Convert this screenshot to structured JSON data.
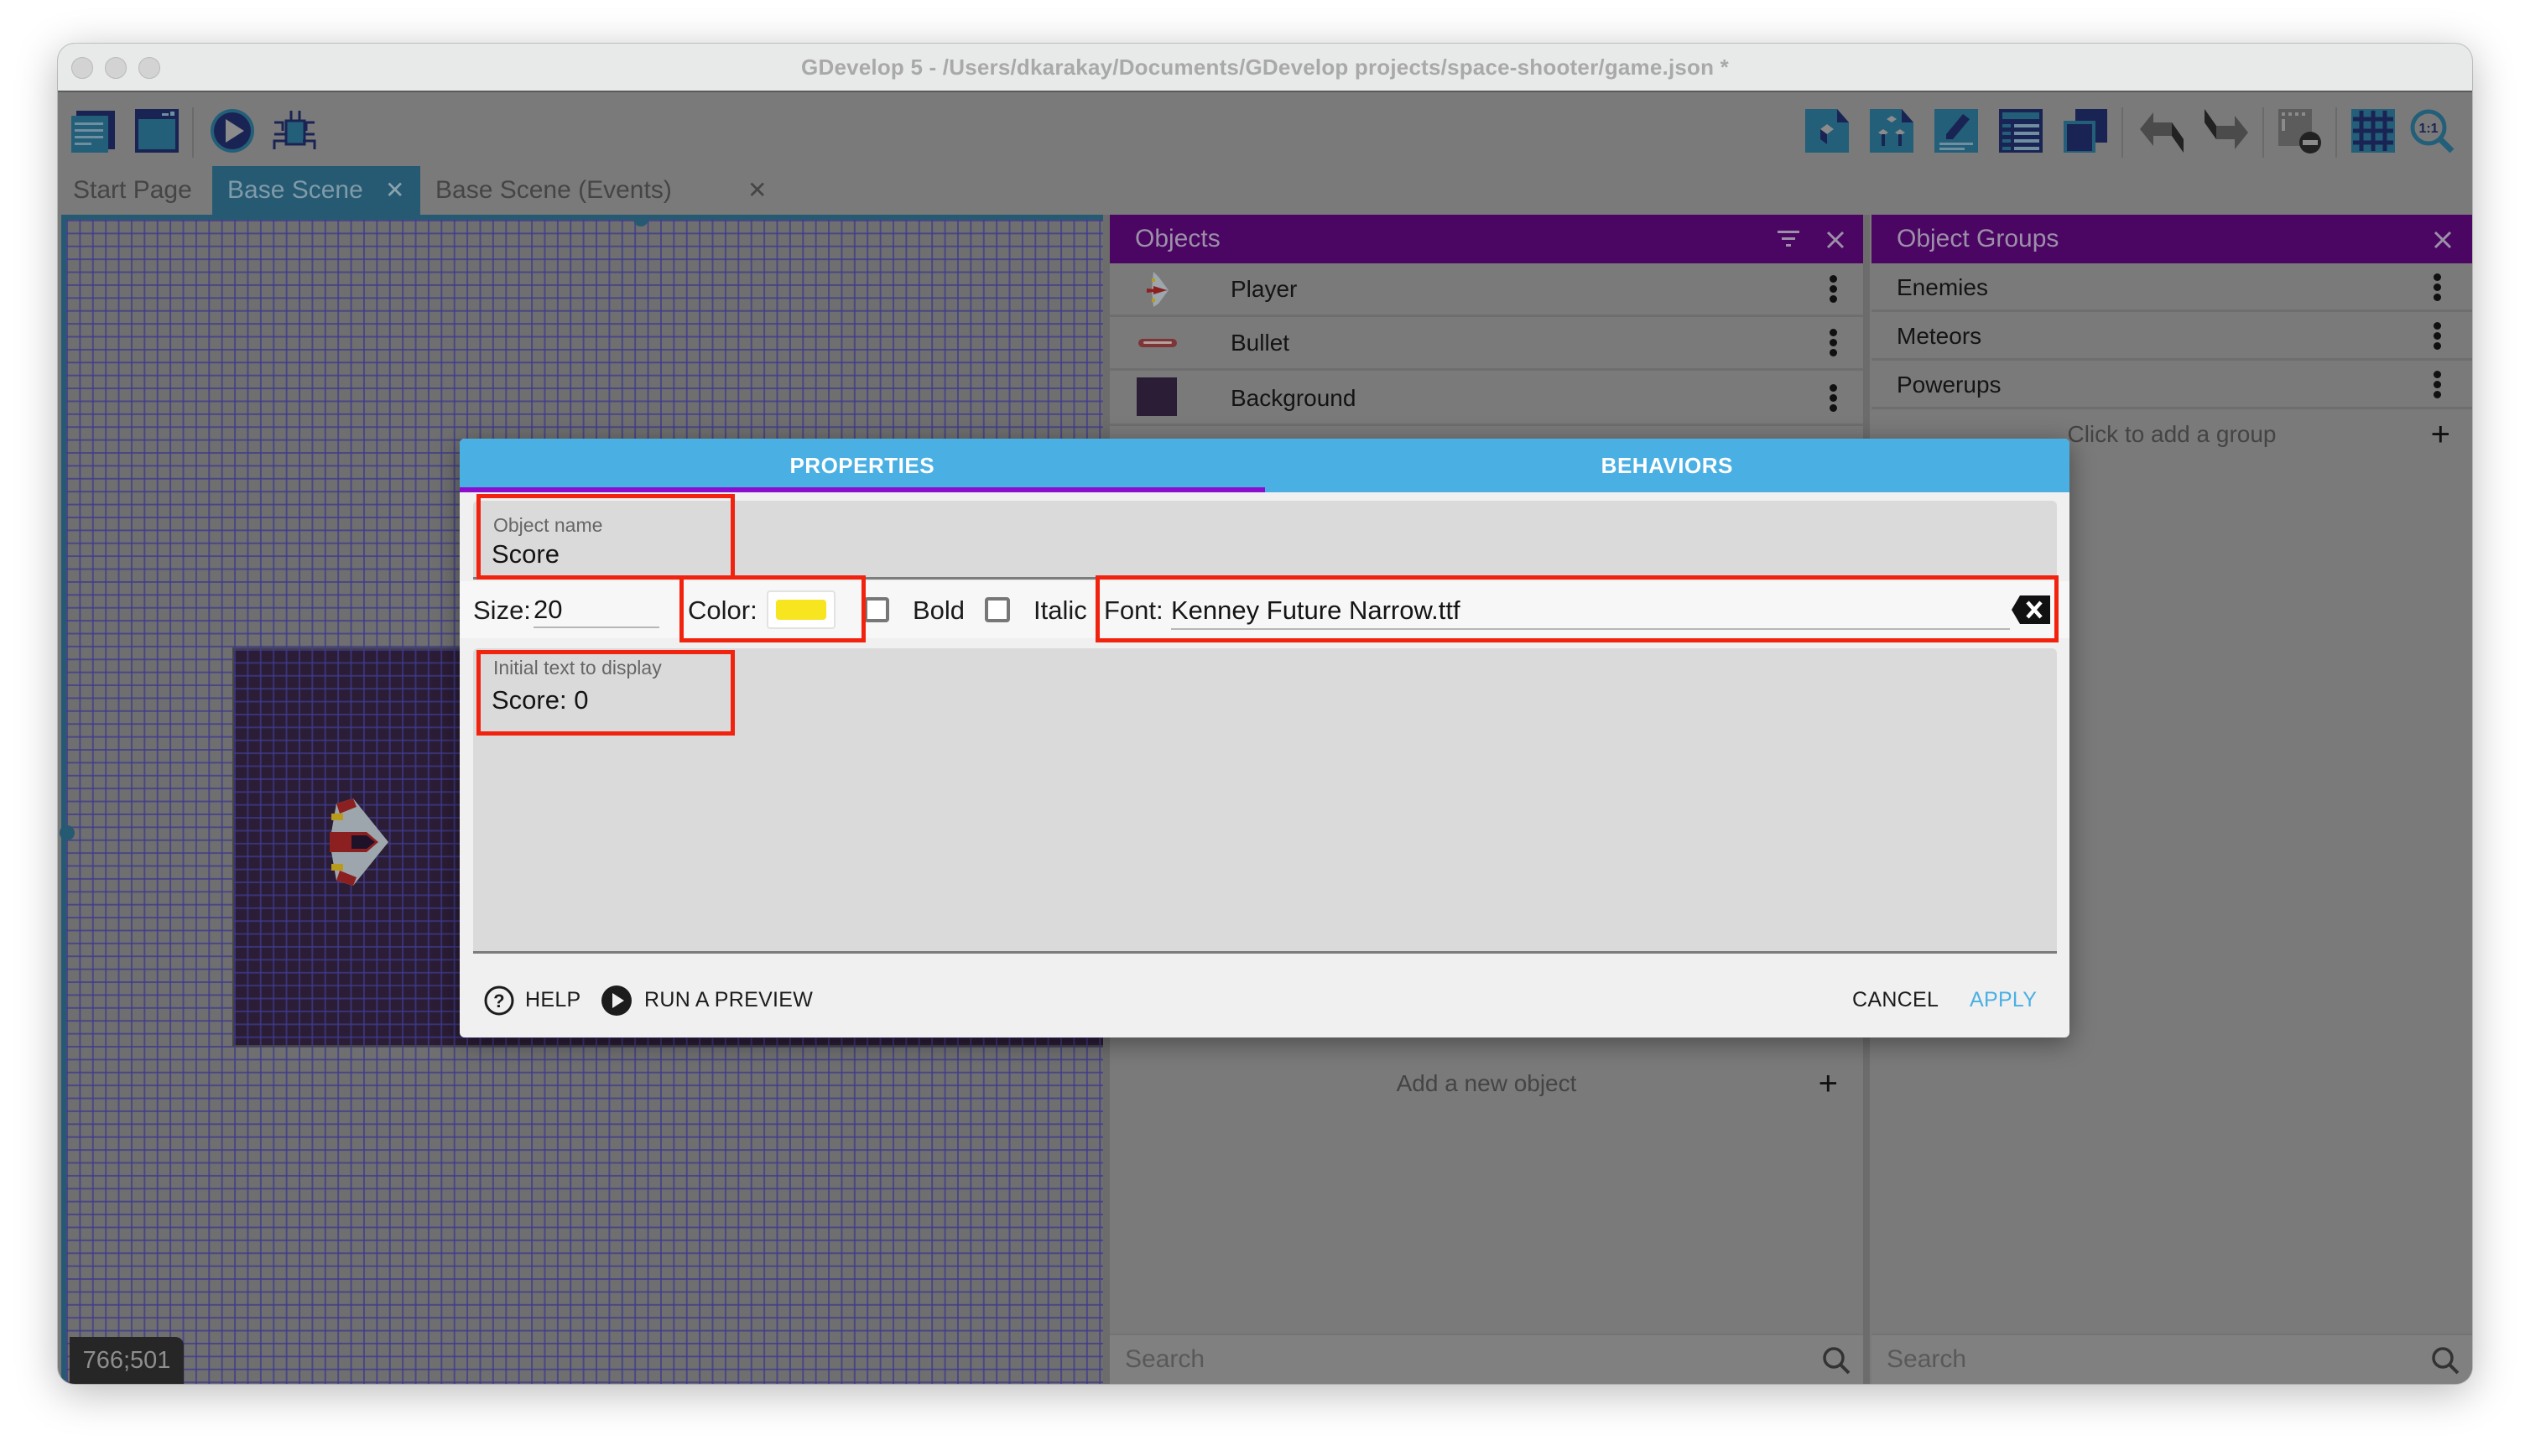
{
  "window": {
    "title": "GDevelop 5 - /Users/dkarakay/Documents/GDevelop projects/space-shooter/game.json *"
  },
  "toolbar": {
    "left_icons": [
      "project-manager-icon",
      "scene-editor-icon",
      "preview-icon",
      "debugger-icon"
    ],
    "right_icons": [
      "object-icon",
      "object-groups-icon",
      "properties-icon",
      "instances-list-icon",
      "layers-icon",
      "undo-icon",
      "redo-icon",
      "delete-icon",
      "grid-icon",
      "zoom-reset-icon"
    ],
    "zoom_reset_label": "1:1"
  },
  "tabs": [
    {
      "label": "Start Page",
      "active": false,
      "closable": false
    },
    {
      "label": "Base Scene",
      "active": true,
      "closable": true
    },
    {
      "label": "Base Scene (Events)",
      "active": false,
      "closable": true
    }
  ],
  "tab_close_glyph": "✕",
  "canvas": {
    "cursor_coords": "766;501"
  },
  "objects_panel": {
    "title": "Objects",
    "items": [
      {
        "name": "Player",
        "thumb": "ship"
      },
      {
        "name": "Bullet",
        "thumb": "bullet"
      },
      {
        "name": "Background",
        "thumb": "background"
      }
    ],
    "add_label": "Add a new object",
    "search_placeholder": "Search"
  },
  "groups_panel": {
    "title": "Object Groups",
    "items": [
      {
        "name": "Enemies"
      },
      {
        "name": "Meteors"
      },
      {
        "name": "Powerups"
      }
    ],
    "add_label": "Click to add a group",
    "search_placeholder": "Search"
  },
  "dialog": {
    "tabs": [
      {
        "label": "PROPERTIES",
        "active": true
      },
      {
        "label": "BEHAVIORS",
        "active": false
      }
    ],
    "object_name": {
      "label": "Object name",
      "value": "Score"
    },
    "size": {
      "label": "Size:",
      "value": "20"
    },
    "color": {
      "label": "Color:",
      "value": "#f7e51f"
    },
    "bold": {
      "label": "Bold",
      "checked": false
    },
    "italic": {
      "label": "Italic",
      "checked": false
    },
    "font": {
      "label": "Font:",
      "value": "Kenney Future Narrow.ttf"
    },
    "initial_text": {
      "label": "Initial text to display",
      "value": "Score: 0"
    },
    "footer": {
      "help": "HELP",
      "preview": "RUN A PREVIEW",
      "cancel": "CANCEL",
      "apply": "APPLY"
    }
  },
  "colors": {
    "panel_header": "#4b0663",
    "dialog_tab_bar": "#4ab0e4",
    "tab_indicator": "#8b0ecf",
    "apply": "#4ab0e4",
    "highlight": "#f2230e",
    "active_tab": "#265a72"
  }
}
